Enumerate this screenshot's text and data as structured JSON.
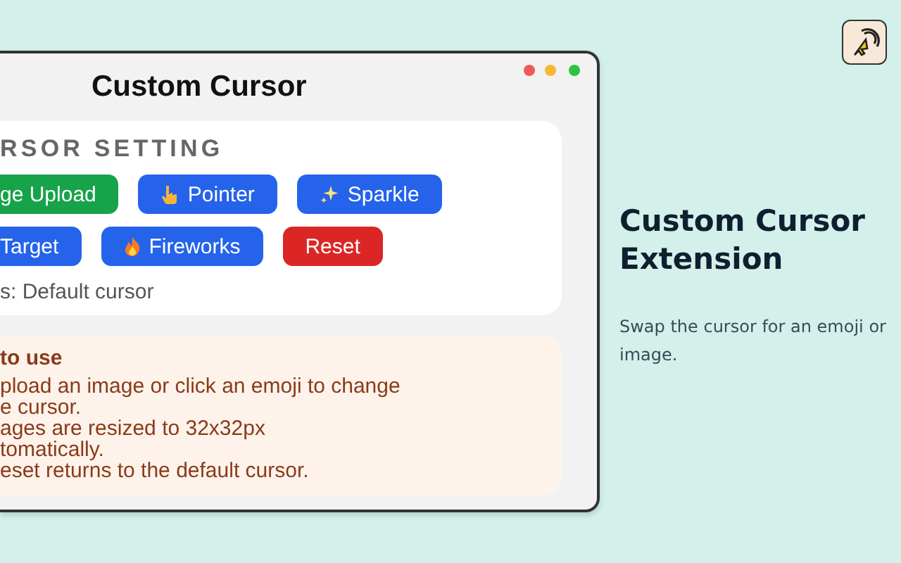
{
  "popup": {
    "title": "Custom Cursor",
    "settings": {
      "heading": "RSOR SETTING",
      "buttons": [
        [
          {
            "label": "ge Upload",
            "kind": "upload"
          },
          {
            "label": "Pointer",
            "kind": "pointer"
          },
          {
            "label": "Sparkle",
            "kind": "sparkle"
          }
        ],
        [
          {
            "label": "Target",
            "kind": "target"
          },
          {
            "label": "Fireworks",
            "kind": "fireworks"
          },
          {
            "label": "Reset",
            "kind": "reset"
          }
        ]
      ],
      "status": "s: Default cursor"
    },
    "help": {
      "title": "to use",
      "lines": [
        "pload an image or click an emoji to change",
        "e cursor.",
        "ages are resized to 32x32px",
        "tomatically.",
        "eset returns to the default cursor."
      ]
    }
  },
  "heading": "Custom Cursor Extension",
  "description": "Swap the cursor for an emoji or image."
}
